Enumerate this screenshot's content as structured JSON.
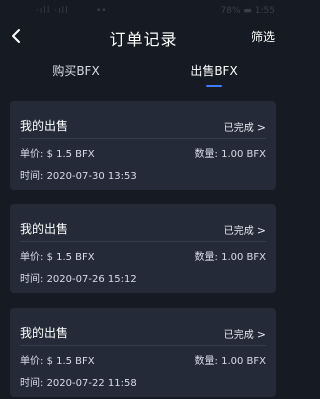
{
  "status_bar": {
    "left": "·ıll ·ıll",
    "mid": "••",
    "right": "78% ▬ 1:55"
  },
  "nav": {
    "title": "订单记录",
    "filter_label": "筛选"
  },
  "tabs": [
    {
      "label": "购买BFX"
    },
    {
      "label": "出售BFX"
    }
  ],
  "orders": [
    {
      "title": "我的出售",
      "status": "已完成",
      "price_label": "单价:",
      "price": "$ 1.5 BFX",
      "qty_label": "数量:",
      "qty": "1.00 BFX",
      "time_label": "时间:",
      "time": "2020-07-30 13:53"
    },
    {
      "title": "我的出售",
      "status": "已完成",
      "price_label": "单价:",
      "price": "$ 1.5 BFX",
      "qty_label": "数量:",
      "qty": "1.00 BFX",
      "time_label": "时间:",
      "time": "2020-07-26 15:12"
    },
    {
      "title": "我的出售",
      "status": "已完成",
      "price_label": "单价:",
      "price": "$ 1.5 BFX",
      "qty_label": "数量:",
      "qty": "1.00 BFX",
      "time_label": "时间:",
      "time": "2020-07-22 11:58"
    }
  ],
  "icons": {
    "back": "chevron-left-icon",
    "status_arrow": "chevron-right-icon"
  },
  "colors": {
    "background": "#161a22",
    "card": "#242a38",
    "accent": "#3d7bff"
  }
}
